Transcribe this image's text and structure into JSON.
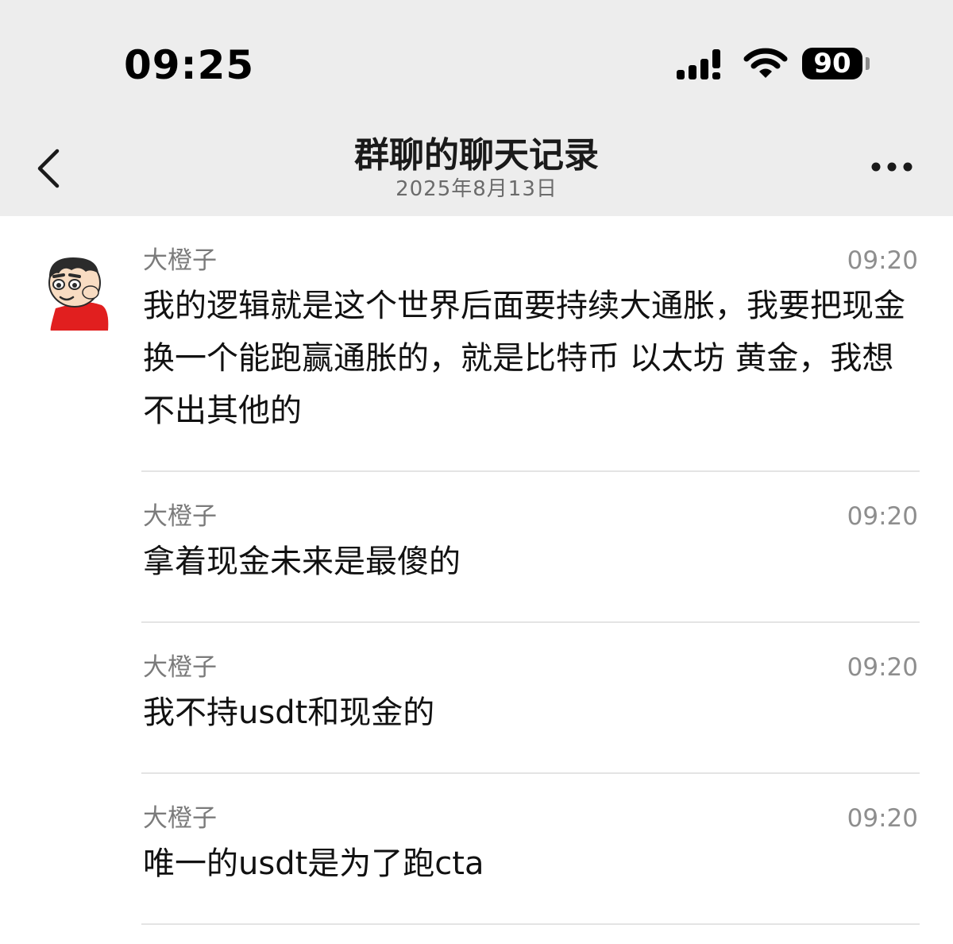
{
  "status_bar": {
    "time": "09:25",
    "battery": "90",
    "icons": [
      "signal-icon",
      "wifi-icon",
      "battery-icon"
    ]
  },
  "nav": {
    "title": "群聊的聊天记录",
    "subtitle": "2025年8月13日",
    "icons": [
      "back-chevron-icon",
      "more-dots-icon"
    ]
  },
  "messages": [
    {
      "sender": "大橙子",
      "time": "09:20",
      "text": "我的逻辑就是这个世界后面要持续大通胀，我要把现金换一个能跑赢通胀的，就是比特币 以太坊 黄金，我想不出其他的"
    },
    {
      "sender": "大橙子",
      "time": "09:20",
      "text": "拿着现金未来是最傻的"
    },
    {
      "sender": "大橙子",
      "time": "09:20",
      "text": "我不持usdt和现金的"
    },
    {
      "sender": "大橙子",
      "time": "09:20",
      "text": "唯一的usdt是为了跑cta"
    }
  ],
  "colors": {
    "header_bg": "#ededed",
    "body_bg": "#ffffff",
    "meta_text": "#7b7b7b",
    "divider": "#e4e4e4",
    "avatar_shirt": "#e11f1f"
  }
}
